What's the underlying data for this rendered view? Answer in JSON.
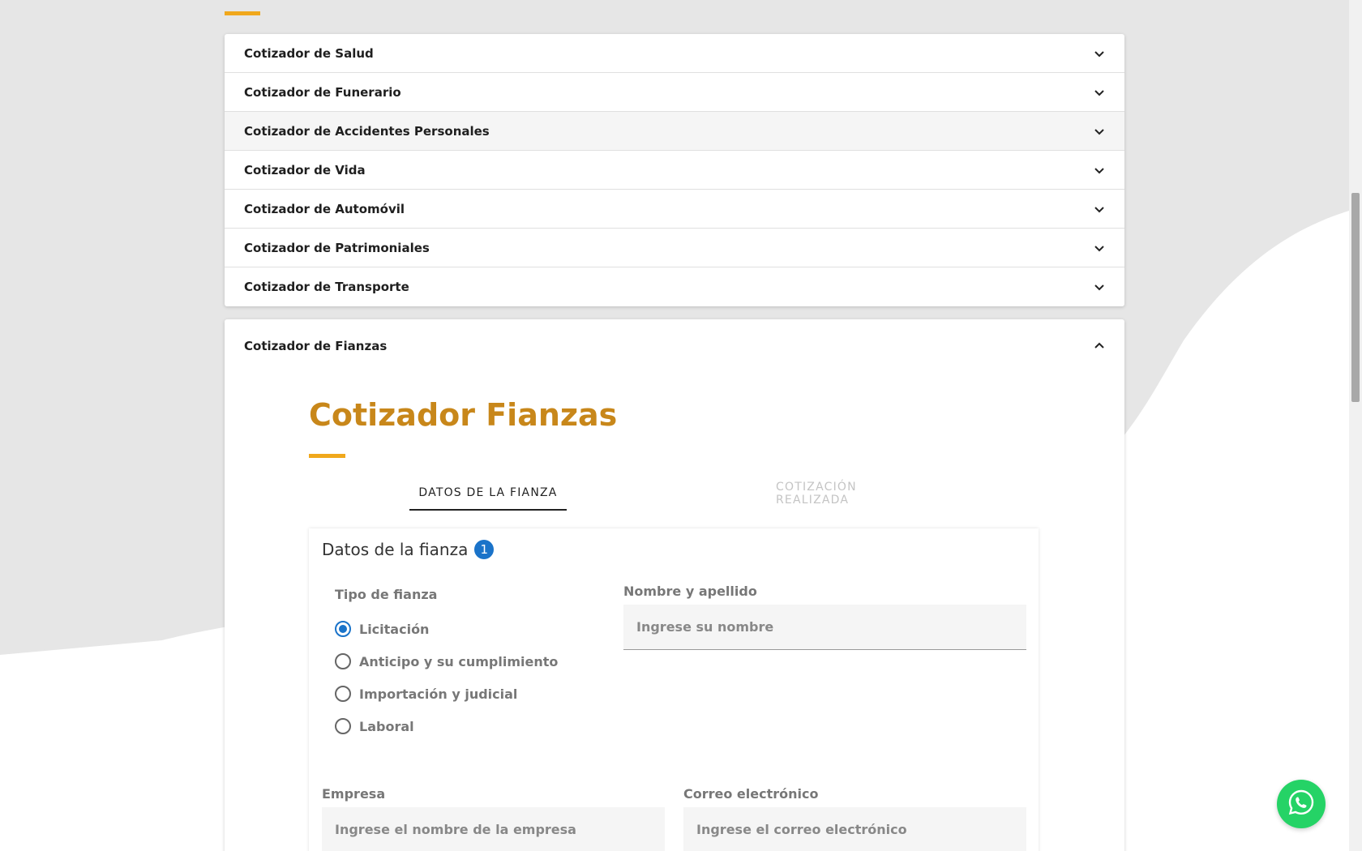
{
  "accordion": {
    "items": [
      {
        "label": "Cotizador de Salud"
      },
      {
        "label": "Cotizador de Funerario"
      },
      {
        "label": "Cotizador de Accidentes Personales"
      },
      {
        "label": "Cotizador de Vida"
      },
      {
        "label": "Cotizador de Automóvil"
      },
      {
        "label": "Cotizador de Patrimoniales"
      },
      {
        "label": "Cotizador de Transporte"
      }
    ],
    "expanded": {
      "label": "Cotizador de Fianzas"
    }
  },
  "fianzas": {
    "title": "Cotizador Fianzas",
    "steps": {
      "active": "DATOS DE LA FIANZA",
      "inactive": "COTIZACIÓN REALIZADA"
    },
    "card": {
      "title": "Datos de la fianza",
      "badge": "1"
    },
    "tipo": {
      "label": "Tipo de fianza",
      "options": [
        "Licitación",
        "Anticipo y su cumplimiento",
        "Importación y judicial",
        "Laboral"
      ],
      "selected": "Licitación"
    },
    "nombre": {
      "label": "Nombre y apellido",
      "placeholder": "Ingrese su nombre"
    },
    "empresa": {
      "label": "Empresa",
      "placeholder": "Ingrese el nombre de la empresa"
    },
    "correo": {
      "label": "Correo electrónico",
      "placeholder": "Ingrese el correo electrónico"
    }
  },
  "colors": {
    "accent": "#f0a81c",
    "title": "#c8871a",
    "primary": "#1a73c9",
    "whatsapp": "#25d366"
  },
  "icons": {
    "chevron": "chevron-down-icon",
    "chevron_up": "chevron-up-icon",
    "whatsapp": "whatsapp-icon"
  }
}
